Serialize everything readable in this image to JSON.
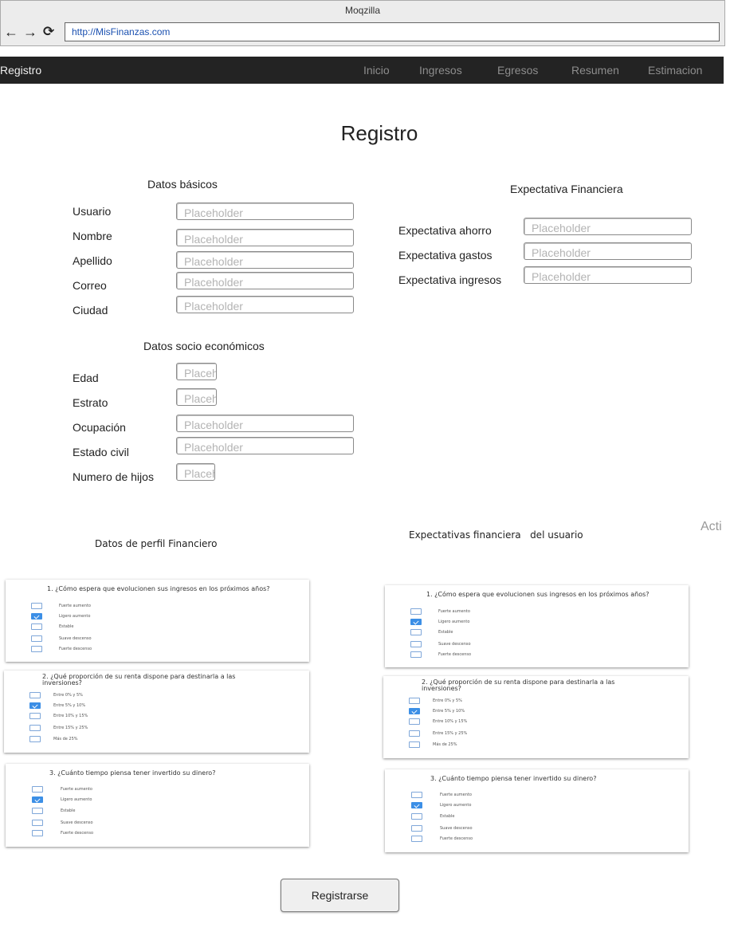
{
  "browser": {
    "title": "Moqzilla",
    "url": "http://MisFinanzas.com",
    "back_glyph": "←",
    "forward_glyph": "→",
    "reload_glyph": "⟳"
  },
  "navbar": {
    "brand": "Registro",
    "items": [
      "Inicio",
      "Ingresos",
      "Egresos",
      "Resumen",
      "Estimacion"
    ]
  },
  "page": {
    "title": "Registro"
  },
  "datos_basicos": {
    "title": "Datos básicos",
    "fields": [
      {
        "label": "Usuario",
        "placeholder": "Placeholder"
      },
      {
        "label": "Nombre",
        "placeholder": "Placeholder"
      },
      {
        "label": "Apellido",
        "placeholder": "Placeholder"
      },
      {
        "label": "Correo",
        "placeholder": "Placeholder"
      },
      {
        "label": "Ciudad",
        "placeholder": "Placeholder"
      }
    ]
  },
  "expectativa_financiera": {
    "title": "Expectativa Financiera",
    "fields": [
      {
        "label": "Expectativa ahorro",
        "placeholder": "Placeholder"
      },
      {
        "label": "Expectativa gastos",
        "placeholder": "Placeholder"
      },
      {
        "label": "Expectativa ingresos",
        "placeholder": "Placeholder"
      }
    ]
  },
  "datos_socio": {
    "title": "Datos socio económicos",
    "fields": [
      {
        "label": "Edad",
        "placeholder": "Placeh"
      },
      {
        "label": "Estrato",
        "placeholder": "Placeh"
      },
      {
        "label": "Ocupación",
        "placeholder": "Placeholder"
      },
      {
        "label": "Estado civil",
        "placeholder": "Placeholder"
      },
      {
        "label": "Numero de hijos",
        "placeholder": "Placeh"
      }
    ]
  },
  "side_text": "Acti",
  "perfil_financiero": {
    "title": "Datos de perfil Financiero",
    "questions": [
      {
        "text": "1. ¿Cómo espera que evolucionen sus ingresos en los próximos años?",
        "options": [
          "Fuerte aumento",
          "Ligero aumento",
          "Estable",
          "Suave descenso",
          "Fuerte descenso"
        ],
        "checked": 1
      },
      {
        "text": "2. ¿Qué proporción de su renta dispone para destinarla a las inversiones?",
        "options": [
          "Entre 0% y 5%",
          "Entre 5% y 10%",
          "Entre 10% y 15%",
          "Entre 15% y 25%",
          "Más de 25%"
        ],
        "checked": 1
      },
      {
        "text": "3. ¿Cuánto tiempo piensa tener invertido su dinero?",
        "options": [
          "Fuerte aumento",
          "Ligero aumento",
          "Estable",
          "Suave descenso",
          "Fuerte descenso"
        ],
        "checked": 1
      }
    ]
  },
  "expectativas_usuario": {
    "title": "Expectativas financiera   del usuario",
    "questions": [
      {
        "text": "1. ¿Cómo espera que evolucionen sus ingresos en los próximos años?",
        "options": [
          "Fuerte aumento",
          "Ligero aumento",
          "Estable",
          "Suave descenso",
          "Fuerte descenso"
        ],
        "checked": 1
      },
      {
        "text": "2. ¿Qué proporción de su renta dispone para destinarla a las inversiones?",
        "options": [
          "Entre 0% y 5%",
          "Entre 5% y 10%",
          "Entre 10% y 15%",
          "Entre 15% y 25%",
          "Más de 25%"
        ],
        "checked": 1
      },
      {
        "text": "3. ¿Cuánto tiempo piensa tener invertido su dinero?",
        "options": [
          "Fuerte aumento",
          "Ligero aumento",
          "Estable",
          "Suave descenso",
          "Fuerte descenso"
        ],
        "checked": 1
      }
    ]
  },
  "register_button": "Registrarse"
}
